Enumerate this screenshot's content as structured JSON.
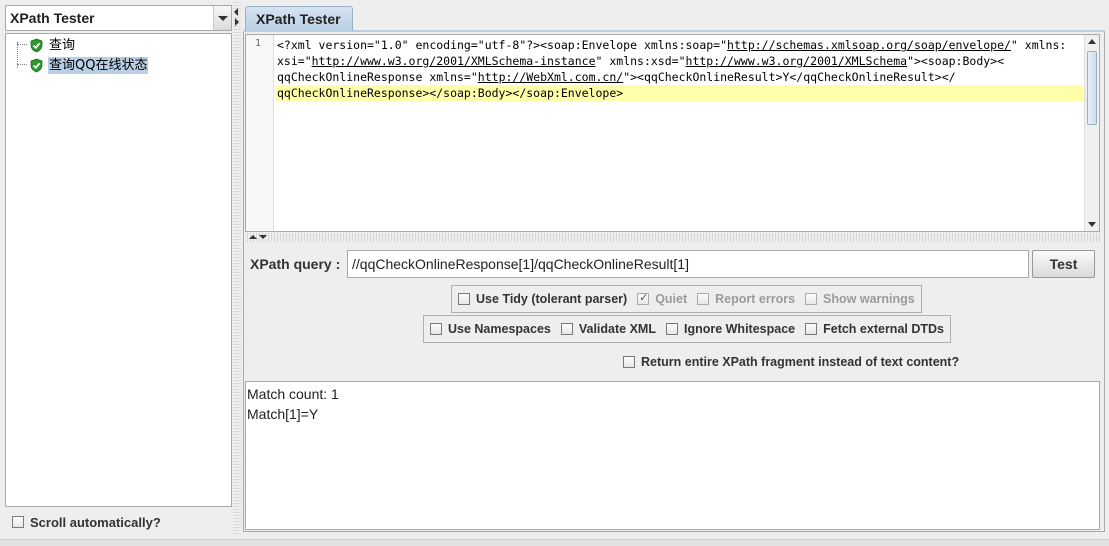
{
  "left_panel": {
    "combo_value": "XPath Tester",
    "tree_items": [
      {
        "label": "查询",
        "icon": "green-shield-check-icon"
      },
      {
        "label": "查询QQ在线状态",
        "icon": "green-shield-check-icon",
        "selected": true
      }
    ],
    "scroll_auto_label": "Scroll automatically?"
  },
  "tab": {
    "label": "XPath Tester"
  },
  "editor": {
    "line_number": "1",
    "lines": [
      [
        {
          "t": "<?xml version=\"1.0\" encoding=\"utf-8\"?><soap:Envelope xmlns:soap=\""
        },
        {
          "t": "http://schemas.xmlsoap.org/soap/envelope/",
          "link": true
        },
        {
          "t": "\" xmlns:"
        }
      ],
      [
        {
          "t": "xsi=\""
        },
        {
          "t": "http://www.w3.org/2001/XMLSchema-instance",
          "link": true
        },
        {
          "t": "\" xmlns:xsd=\""
        },
        {
          "t": "http://www.w3.org/2001/XMLSchema",
          "link": true
        },
        {
          "t": "\"><soap:Body><"
        }
      ],
      [
        {
          "t": "qqCheckOnlineResponse xmlns=\""
        },
        {
          "t": "http://WebXml.com.cn/",
          "link": true
        },
        {
          "t": "\"><qqCheckOnlineResult>Y</qqCheckOnlineResult></"
        }
      ],
      [
        {
          "t": "qqCheckOnlineResponse></soap:Body></soap:Envelope>"
        }
      ]
    ],
    "highlight_line_index": 3
  },
  "query": {
    "label": "XPath query :",
    "value": "//qqCheckOnlineResponse[1]/qqCheckOnlineResult[1]",
    "test_button": "Test"
  },
  "options": {
    "row1": [
      {
        "label": "Use Tidy (tolerant parser)",
        "checked": false,
        "enabled": true
      },
      {
        "label": "Quiet",
        "checked": true,
        "enabled": false
      },
      {
        "label": "Report errors",
        "checked": false,
        "enabled": false
      },
      {
        "label": "Show warnings",
        "checked": false,
        "enabled": false
      }
    ],
    "row2": [
      {
        "label": "Use Namespaces",
        "checked": false,
        "enabled": true
      },
      {
        "label": "Validate XML",
        "checked": false,
        "enabled": true
      },
      {
        "label": "Ignore Whitespace",
        "checked": false,
        "enabled": true
      },
      {
        "label": "Fetch external DTDs",
        "checked": false,
        "enabled": true
      }
    ],
    "fragment": {
      "label": "Return entire XPath fragment instead of text content?",
      "checked": false
    }
  },
  "results": {
    "match_count": "Match count: 1",
    "match_1": "Match[1]=Y"
  },
  "colors": {
    "tab_bg": "#b9cfe4",
    "selection_bg": "#b8cfe5",
    "highlight_line": "#ffffaa",
    "shield_green": "#2e9a2e"
  }
}
